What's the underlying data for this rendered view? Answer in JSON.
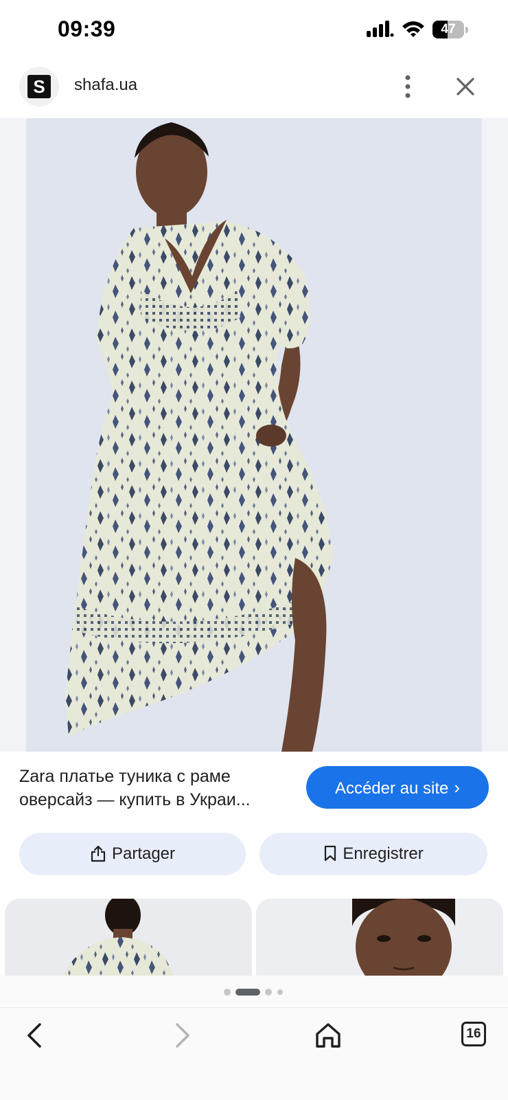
{
  "status_bar": {
    "time": "09:39",
    "battery_level": "47",
    "battery_fraction": 0.47
  },
  "header": {
    "favicon_letter": "S",
    "site_name": "shafa.ua",
    "menu_icon": "more-vert-icon",
    "close_icon": "close-icon"
  },
  "result": {
    "title_line1": "Zara платье туника с раме",
    "title_line2": "оверсайз — купить в Украи...",
    "visit_label": "Accéder au site",
    "visit_chevron": "›",
    "share_label": "Partager",
    "save_label": "Enregistrer"
  },
  "pager": {
    "pages": 4,
    "active_index": 1
  },
  "bottom_nav": {
    "tab_count": "16"
  },
  "colors": {
    "accent": "#1a73e8",
    "chip_background": "#e8eef9",
    "hero_background": "#f2f3f6"
  }
}
